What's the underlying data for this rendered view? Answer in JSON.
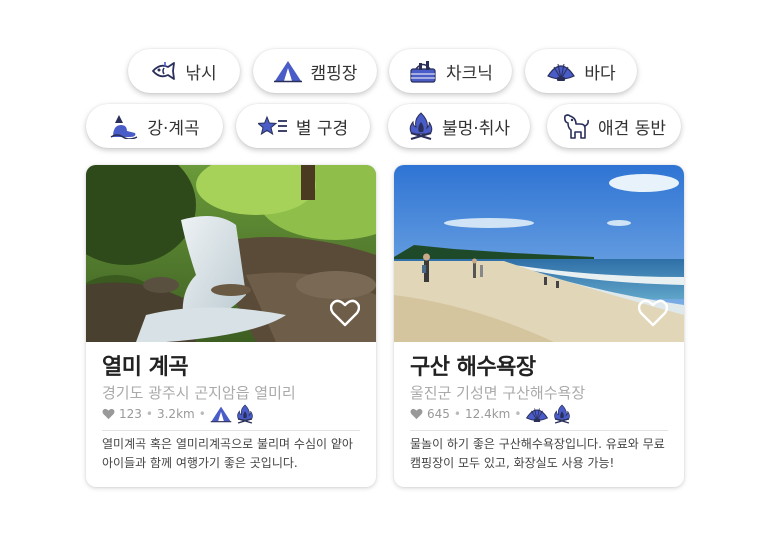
{
  "categories": [
    {
      "label": "낚시",
      "icon": "fishing-icon"
    },
    {
      "label": "캠핑장",
      "icon": "tent-icon"
    },
    {
      "label": "차크닉",
      "icon": "picnic-basket-icon"
    },
    {
      "label": "바다",
      "icon": "seashell-icon"
    },
    {
      "label": "강·계곡",
      "icon": "river-icon"
    },
    {
      "label": "별 구경",
      "icon": "star-gazing-icon"
    },
    {
      "label": "불멍·취사",
      "icon": "campfire-icon"
    },
    {
      "label": "애견 동반",
      "icon": "dog-icon"
    }
  ],
  "cards": [
    {
      "title": "열미 계곡",
      "address": "경기도 광주시 곤지암읍 열미리",
      "likes": "123",
      "distance": "3.2km",
      "tag_icons": [
        "tent-icon",
        "campfire-icon"
      ],
      "description": "열미계곡 혹은 열미리계곡으로 불리며 수심이 얕아 아이들과 함께 여행가기 좋은 곳입니다."
    },
    {
      "title": "구산 해수욕장",
      "address": "울진군 기성면 구산해수욕장",
      "likes": "645",
      "distance": "12.4km",
      "tag_icons": [
        "seashell-icon",
        "campfire-icon"
      ],
      "description": "물놀이 하기 좋은 구산해수욕장입니다. 유료와 무료 캠핑장이 모두 있고, 화장실도 사용 가능!"
    }
  ],
  "colors": {
    "accent": "#4a5cc7",
    "text": "#333333",
    "muted": "#aaaaaa"
  }
}
